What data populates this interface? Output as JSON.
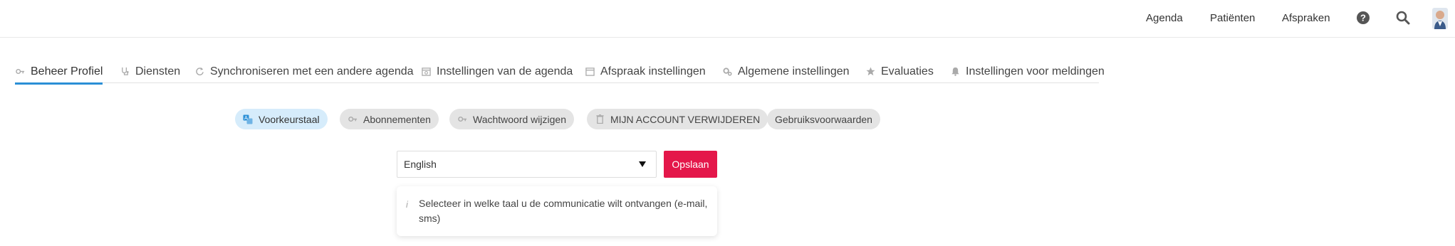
{
  "topnav": {
    "agenda": "Agenda",
    "patients": "Patiënten",
    "appointments": "Afspraken"
  },
  "tabs": [
    {
      "label": "Beheer Profiel",
      "icon": "key-icon"
    },
    {
      "label": "Diensten",
      "icon": "stethoscope-icon"
    },
    {
      "label": "Synchroniseren met een andere agenda",
      "icon": "sync-icon"
    },
    {
      "label": "Instellingen van de agenda",
      "icon": "calendar-clock-icon"
    },
    {
      "label": "Afspraak instellingen",
      "icon": "calendar-icon"
    },
    {
      "label": "Algemene instellingen",
      "icon": "gears-icon"
    },
    {
      "label": "Evaluaties",
      "icon": "star-icon"
    },
    {
      "label": "Instellingen voor meldingen",
      "icon": "bell-icon"
    }
  ],
  "subtabs": [
    {
      "label": "Voorkeurstaal",
      "icon": "translate-icon"
    },
    {
      "label": "Abonnementen",
      "icon": "key-icon"
    },
    {
      "label": "Wachtwoord wijzigen",
      "icon": "key-icon"
    },
    {
      "label": "MIJN ACCOUNT VERWIJDEREN",
      "icon": "trash-icon"
    },
    {
      "label": "Gebruiksvoorwaarden",
      "icon": ""
    }
  ],
  "language": {
    "selected": "English",
    "save_label": "Opslaan",
    "info_text": "Selecteer in welke taal u de communicatie wilt ontvangen (e-mail, sms)"
  },
  "colors": {
    "accent": "#2b8fd6",
    "save": "#e4174a",
    "pill": "#e4e4e4",
    "pill_active": "#d6ecfb"
  }
}
